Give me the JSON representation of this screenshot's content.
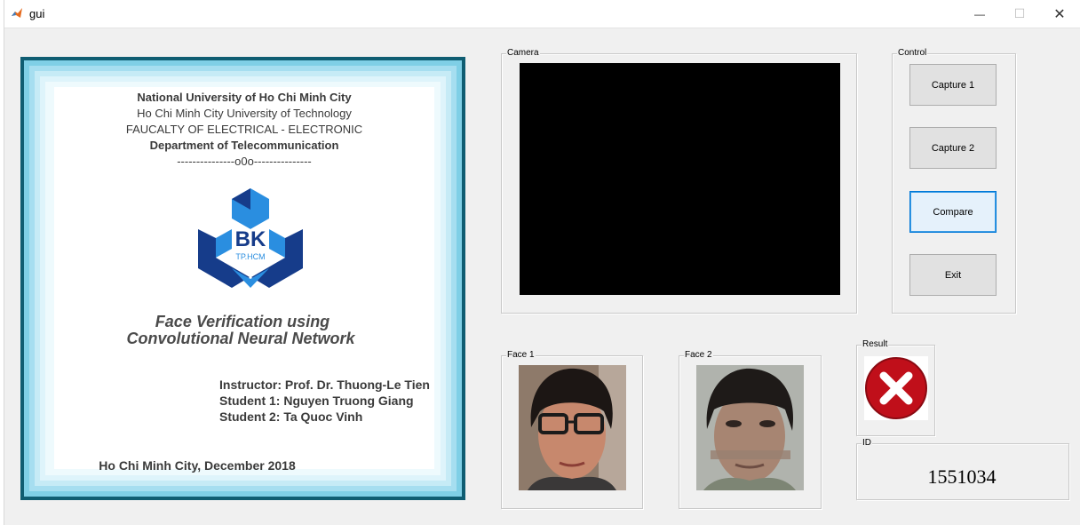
{
  "window": {
    "title": "gui",
    "minimize_glyph": "—",
    "maximize_glyph": "☐",
    "close_glyph": "✕"
  },
  "poster": {
    "line1": "National University of Ho Chi Minh City",
    "line2": "Ho Chi Minh City University of Technology",
    "line3": "FAUCALTY OF ELECTRICAL - ELECTRONIC",
    "line4": "Department of Telecommunication",
    "separator": "---------------o0o---------------",
    "logo_text": "BK",
    "logo_subtext": "TP.HCM",
    "title_line1": "Face Verification using",
    "title_line2": "Convolutional Neural Network",
    "instructor": "Instructor: Prof. Dr. Thuong-Le Tien",
    "student1": "Student 1: Nguyen Truong Giang",
    "student2": "Student 2: Ta Quoc Vinh",
    "footer": "Ho Chi Minh City, December 2018"
  },
  "camera": {
    "label": "Camera"
  },
  "control": {
    "label": "Control",
    "capture1": "Capture 1",
    "capture2": "Capture 2",
    "compare": "Compare",
    "exit": "Exit"
  },
  "face1": {
    "label": "Face 1"
  },
  "face2": {
    "label": "Face 2"
  },
  "result": {
    "label": "Result",
    "icon": "x-circle-icon",
    "color": "#d0121b"
  },
  "id_panel": {
    "label": "ID",
    "value": "1551034"
  },
  "colors": {
    "poster_border": "#0f5d72",
    "logo_dark": "#163c8a",
    "logo_light": "#2a8ee0",
    "window_bg": "#f0f0f0"
  }
}
